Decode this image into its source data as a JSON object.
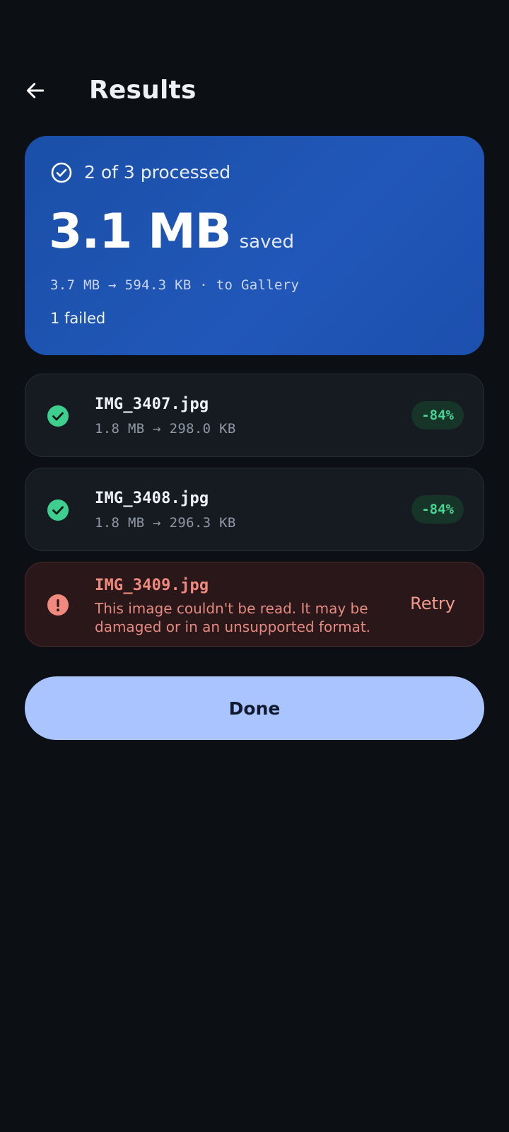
{
  "header": {
    "title": "Results",
    "back_icon": "arrow-left-icon"
  },
  "summary": {
    "processed": "2 of 3 processed",
    "saved_amount": "3.1 MB",
    "saved_label": "saved",
    "size_line": "3.7 MB → 594.3 KB · to Gallery",
    "failed": "1 failed"
  },
  "files": [
    {
      "name": "IMG_3407.jpg",
      "sizes": "1.8 MB → 298.0 KB",
      "badge": "-84%",
      "status": "success"
    },
    {
      "name": "IMG_3408.jpg",
      "sizes": "1.8 MB → 296.3 KB",
      "badge": "-84%",
      "status": "success"
    },
    {
      "name": "IMG_3409.jpg",
      "message": "This image couldn't be read. It may be damaged or in an unsupported format.",
      "retry_label": "Retry",
      "status": "error"
    }
  ],
  "done_label": "Done",
  "colors": {
    "background": "#0c0f14",
    "summary_card": "#1f55b4",
    "success": "#3ecf8e",
    "error": "#f08a7e",
    "done_button": "#a9c4fe"
  }
}
